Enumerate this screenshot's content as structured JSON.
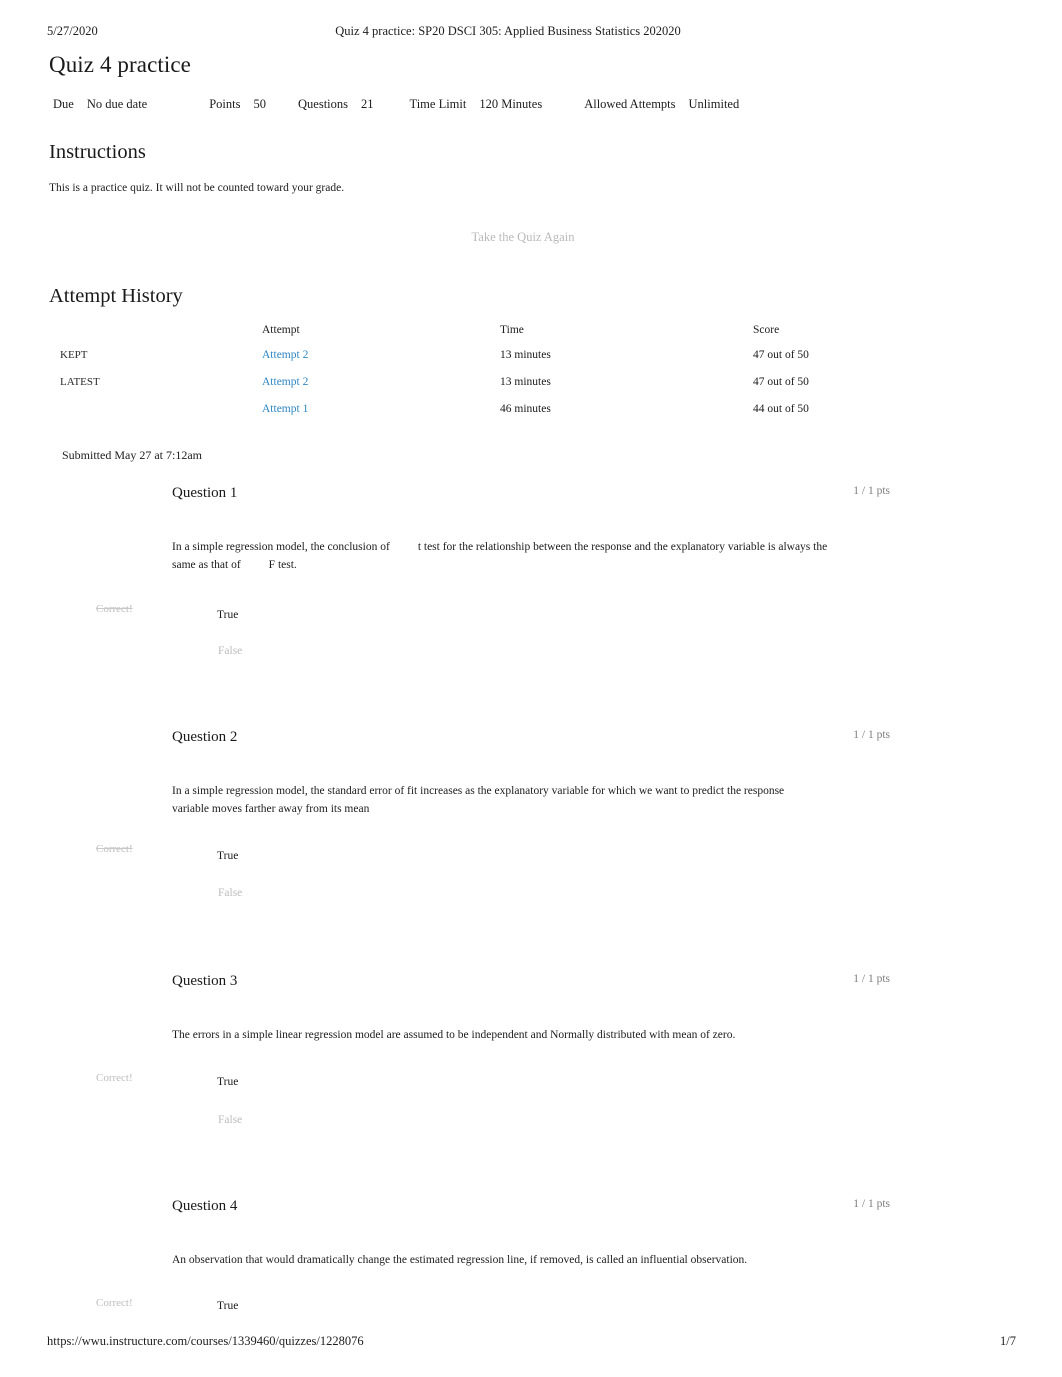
{
  "print_header": {
    "date": "5/27/2020",
    "title": "Quiz 4 practice: SP20 DSCI 305: Applied Business Statistics 202020"
  },
  "page_title": "Quiz 4 practice",
  "quiz_meta": {
    "due_label": "Due",
    "due_value": "No due date",
    "points_label": "Points",
    "points_value": "50",
    "questions_label": "Questions",
    "questions_value": "21",
    "time_limit_label": "Time Limit",
    "time_limit_value": "120 Minutes",
    "attempts_label": "Allowed Attempts",
    "attempts_value": "Unlimited"
  },
  "instructions": {
    "heading": "Instructions",
    "body": "This is a practice quiz. It will not be counted toward your grade."
  },
  "take_again_button": "Take the Quiz Again",
  "attempt_history": {
    "heading": "Attempt History",
    "columns": [
      "",
      "Attempt",
      "Time",
      "Score"
    ],
    "rows": [
      {
        "flag": "KEPT",
        "attempt": "Attempt 2",
        "time": "13 minutes",
        "score": "47 out of 50"
      },
      {
        "flag": "LATEST",
        "attempt": "Attempt 2",
        "time": "13 minutes",
        "score": "47 out of 50"
      },
      {
        "flag": "",
        "attempt": "Attempt 1",
        "time": "46 minutes",
        "score": "44 out of 50"
      }
    ]
  },
  "submitted": "Submitted May 27 at 7:12am",
  "questions": [
    {
      "label": "Question 1",
      "points": "1 / 1 pts",
      "text_part1": "In a simple regression model, the conclusion of",
      "text_part2": "t test for the relationship between the response and the explanatory variable is always the same as that of",
      "text_part3": "F test.",
      "status": "Correct!",
      "options": [
        {
          "label": "True",
          "state": "selected"
        },
        {
          "label": "False",
          "state": "plain"
        }
      ]
    },
    {
      "label": "Question 2",
      "points": "1 / 1 pts",
      "text_part1": "In a simple regression model, the standard error of fit increases as the explanatory variable for which we want to predict the response variable moves farther away from its mean",
      "text_part2": "",
      "text_part3": "",
      "status": "Correct!",
      "options": [
        {
          "label": "True",
          "state": "selected"
        },
        {
          "label": "False",
          "state": "plain"
        }
      ]
    },
    {
      "label": "Question 3",
      "points": "1 / 1 pts",
      "text_part1": "The errors in a simple linear regression model are assumed to be independent and Normally distributed with mean of zero.",
      "text_part2": "",
      "text_part3": "",
      "status": "Correct!",
      "options": [
        {
          "label": "True",
          "state": "selected"
        },
        {
          "label": "False",
          "state": "plain"
        }
      ]
    },
    {
      "label": "Question 4",
      "points": "1 / 1 pts",
      "text_part1": "An observation that would dramatically change the estimated regression line, if removed, is called an influential observation.",
      "text_part2": "",
      "text_part3": "",
      "status": "Correct!",
      "options": [
        {
          "label": "True",
          "state": "selected"
        }
      ]
    }
  ],
  "print_footer": {
    "url": "https://wwu.instructure.com/courses/1339460/quizzes/1228076",
    "page": "1/7"
  },
  "colors": {
    "link": "#2f86c4",
    "muted": "#bdbdbd",
    "points": "#7d7d7d",
    "text": "#1d1d1d"
  }
}
